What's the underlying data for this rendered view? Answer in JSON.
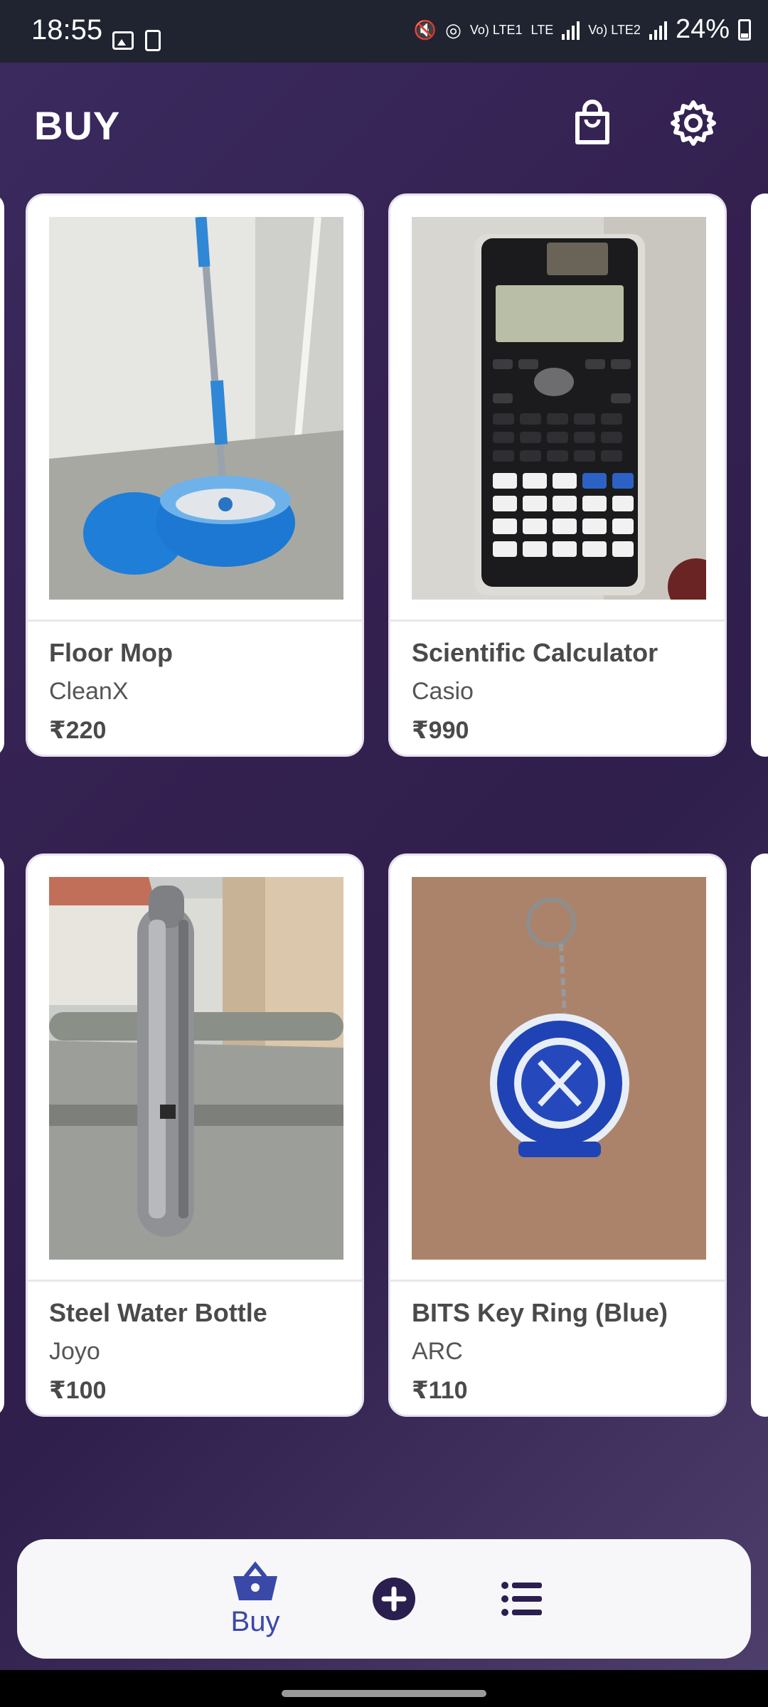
{
  "status_bar": {
    "time": "18:55",
    "net1": "Vo) LTE1",
    "net2": "LTE",
    "net3": "Vo) LTE2",
    "battery": "24%"
  },
  "header": {
    "title": "BUY",
    "icons": [
      "shopping-bag-icon",
      "settings-gear-icon"
    ]
  },
  "products": [
    {
      "name": "Floor Mop",
      "brand": "CleanX",
      "price": "₹220",
      "image": "mop-photo"
    },
    {
      "name": "Scientific Calculator",
      "brand": "Casio",
      "price": "₹990",
      "image": "calculator-photo"
    },
    {
      "name": "Steel Water Bottle",
      "brand": "Joyo",
      "price": "₹100",
      "image": "bottle-photo"
    },
    {
      "name": "BITS Key Ring (Blue)",
      "brand": "ARC",
      "price": "₹110",
      "image": "keyring-photo"
    }
  ],
  "nav": {
    "buy_label": "Buy",
    "items": [
      "basket-icon",
      "add-circle-icon",
      "list-icon"
    ],
    "accent": "#3a48a8"
  },
  "colors": {
    "background_gradient": [
      "#3a2a5e",
      "#4d3e6c"
    ],
    "card": "#ffffff",
    "text": "#4a4a4a"
  }
}
